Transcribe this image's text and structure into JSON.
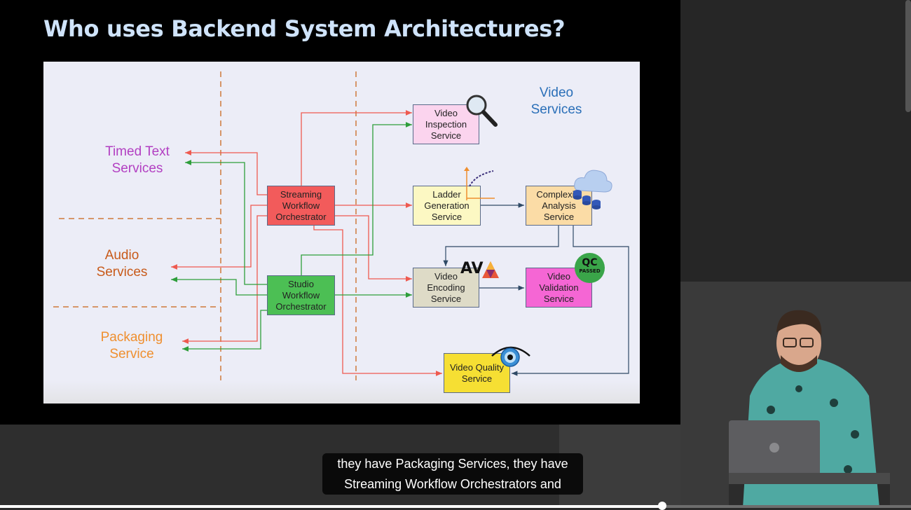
{
  "slide": {
    "title": "Who uses Backend System Architectures?"
  },
  "diagram": {
    "groups": {
      "timed_text": [
        "Timed Text",
        "Services"
      ],
      "audio": [
        "Audio",
        "Services"
      ],
      "packaging": [
        "Packaging",
        "Service"
      ],
      "video": [
        "Video",
        "Services"
      ]
    },
    "nodes": {
      "streaming": "Streaming\nWorkflow\nOrchestrator",
      "studio": "Studio\nWorkflow\nOrchestrator",
      "inspection": "Video\nInspection\nService",
      "ladder": "Ladder\nGeneration\nService",
      "complexity": "Complexity\nAnalysis\nService",
      "encoding": "Video\nEncoding\nService",
      "validation": "Video\nValidation\nService",
      "quality": "Video Quality\nService"
    },
    "badges": {
      "av_logo": "AV",
      "qc_title": "QC",
      "qc_subtitle": "PASSED"
    },
    "icons": [
      "magnifier-icon",
      "graph-icon",
      "cloud-database-icon",
      "av1-logo-icon",
      "qc-passed-badge-icon",
      "eye-dial-icon"
    ],
    "colors": {
      "streaming": "#f25b5b",
      "studio": "#4cbf54",
      "inspection": "#fbd4ee",
      "ladder": "#fcf8c3",
      "complexity": "#fbdca6",
      "encoding": "#dedbc7",
      "validation": "#f566d4",
      "quality": "#f6df33",
      "timed_text": "#b23fc2",
      "audio": "#c85a1a",
      "packaging": "#ef8f2f",
      "video": "#2a6fb8"
    }
  },
  "captions": {
    "line1": "they have Packaging Services, they have",
    "line2": "Streaming Workflow Orchestrators and"
  },
  "player": {
    "progress": 0.727
  }
}
